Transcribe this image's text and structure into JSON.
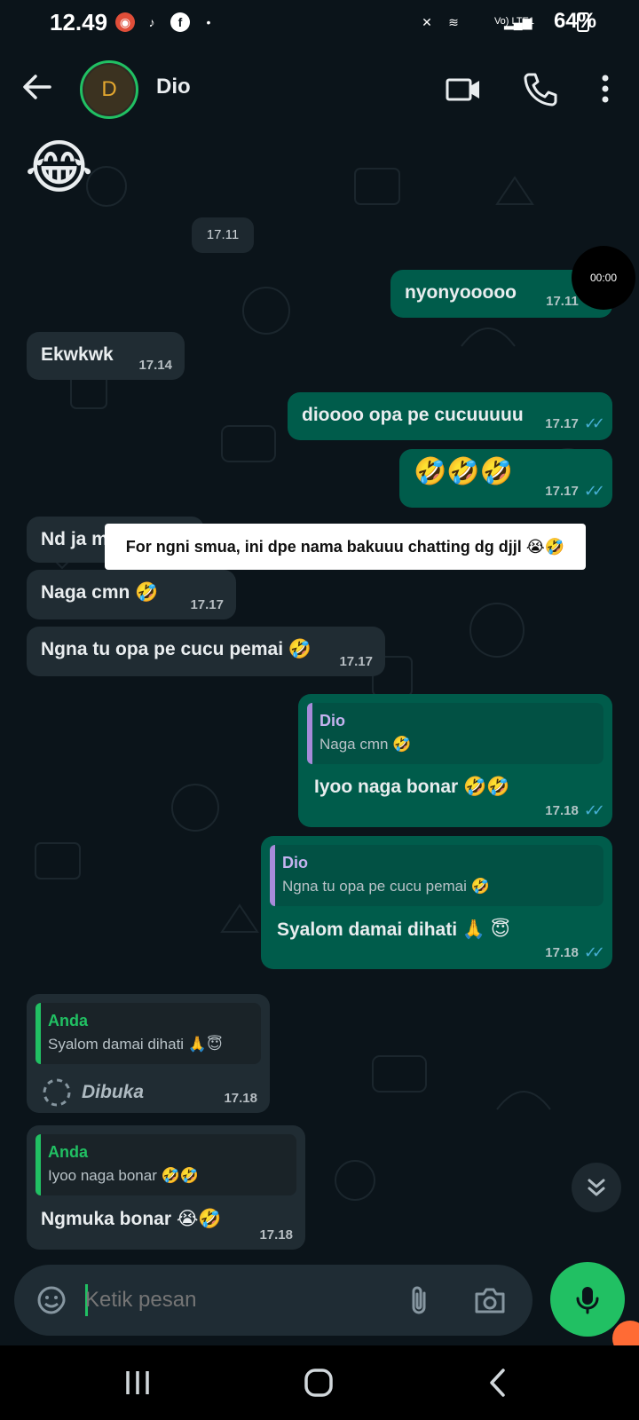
{
  "status_bar": {
    "time": "12.49",
    "signal_text": "Vo) LTE1",
    "battery": "64%"
  },
  "header": {
    "avatar_letter": "D",
    "contact_name": "Dio"
  },
  "chat": {
    "emoji_sticker": "😂",
    "date_chip": "17.11",
    "video_timer": "00:00",
    "toast": "For ngni smua, ini dpe nama bakuuu chatting dg djjl 😭🤣",
    "messages": [
      {
        "dir": "out",
        "text": "nyonyooooo",
        "time": "17.11"
      },
      {
        "dir": "in",
        "text": "Ekwkwk",
        "time": "17.14"
      },
      {
        "dir": "out",
        "text": "dioooo opa pe cucuuuuu",
        "time": "17.17"
      },
      {
        "dir": "out",
        "text": "🤣🤣🤣",
        "time": "17.17"
      },
      {
        "dir": "in",
        "text": "Nd ja m",
        "time": "17.17"
      },
      {
        "dir": "in",
        "text": "Naga cmn 🤣",
        "time": "17.17"
      },
      {
        "dir": "in",
        "text": "Ngna tu opa pe cucu pemai 🤣",
        "time": "17.17"
      },
      {
        "dir": "out",
        "quote_author": "Dio",
        "quote_text": "Naga cmn 🤣",
        "text": "Iyoo naga bonar 🤣🤣",
        "time": "17.18"
      },
      {
        "dir": "out",
        "quote_author": "Dio",
        "quote_text": "Ngna tu opa pe cucu pemai 🤣",
        "text": "Syalom damai dihati 🙏 😇",
        "time": "17.18"
      },
      {
        "dir": "in",
        "quote_author": "Anda",
        "quote_text": "Syalom damai dihati 🙏😇",
        "text": "Dibuka",
        "time": "17.18"
      },
      {
        "dir": "in",
        "quote_author": "Anda",
        "quote_text": "Iyoo naga bonar 🤣🤣",
        "text": "Ngmuka bonar 😭🤣",
        "time": "17.18"
      }
    ]
  },
  "composer": {
    "placeholder": "Ketik pesan"
  },
  "colors": {
    "accent": "#21c063",
    "outgoing": "#005c4b",
    "incoming": "#202c33",
    "background": "#0b141a",
    "ticks": "#53bdeb"
  },
  "icons": [
    "back-arrow-icon",
    "video-call-icon",
    "phone-icon",
    "more-vert-icon",
    "sticker-icon",
    "attach-icon",
    "camera-icon",
    "mic-icon",
    "chevron-double-down-icon",
    "loading-spinner-icon",
    "recents-icon",
    "home-icon",
    "back-nav-icon"
  ]
}
